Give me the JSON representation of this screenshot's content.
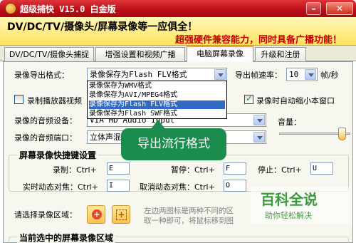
{
  "window": {
    "title": "超级捕快 V15.0 白金版",
    "minimize_glyph": "–",
    "close_glyph": "✕",
    "accent_color": "#b80d17"
  },
  "banner": {
    "line1": "DV/DC/TV/摄像头/屏幕录像等一应俱全！",
    "line2": "超强硬件兼容能力，同时具备广播功能！"
  },
  "tabs": [
    {
      "label": "DV/DC/TV/摄像头捕捉"
    },
    {
      "label": "增强设置和视频广播"
    },
    {
      "label": "电脑屏幕录像",
      "active": true
    },
    {
      "label": "升级和注册"
    }
  ],
  "format": {
    "label": "录像导出格式：",
    "value": "录像保存为Flash FLV格式",
    "options": [
      "录像保存为WMV格式",
      "录像保存为AVI/MPEG4格式",
      "录像保存为Flash FLV格式",
      "录像保存为Flash SWF格式"
    ],
    "selected_index": 2
  },
  "fps": {
    "label": "导出帧速率：",
    "value": "10",
    "unit": "帧/秒"
  },
  "record_player": {
    "label": "录制播放器视频",
    "checked": false
  },
  "auto_minimize": {
    "label": "录像时自动缩小本窗口",
    "checked": true
  },
  "audio_device": {
    "label": "录像的音频设备：",
    "value": "VIA HD Audio Input"
  },
  "audio_port": {
    "label": "录像的音频端口：",
    "value": "立体声混"
  },
  "volume": {
    "label": "音量：",
    "level": 0.93
  },
  "hotkeys": {
    "title": "屏幕录像快捷键设置",
    "record_label": "录制：Ctrl+",
    "record_key": "E",
    "pause_label": "暂停：Ctrl+",
    "pause_key": "F",
    "stop_label": "停止：Ctrl+",
    "stop_key": "U",
    "focus_label": "实时动态对焦：Ctrl+",
    "focus_key": "I",
    "cancel_focus_label": "取消动态对焦：Ctrl+",
    "cancel_focus_key": "O"
  },
  "region": {
    "label": "请选择录像区域：",
    "hint1": "左边两图标是两种不同的区",
    "hint2": "取一种即可，将鼠标移到图"
  },
  "current_region": {
    "title": "当前选中的屏幕录像区域"
  },
  "tooltip": {
    "text": "导出流行格式",
    "color": "#1a8c4d"
  },
  "watermark": {
    "logo": "百科全说",
    "sub": "助你轻松解决"
  }
}
